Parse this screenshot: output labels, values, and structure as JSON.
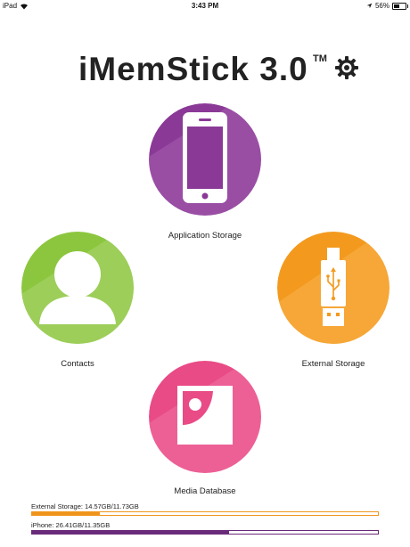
{
  "status_bar": {
    "device": "iPad",
    "time": "3:43 PM",
    "battery": "56%",
    "battery_level": 0.56
  },
  "header": {
    "title": "iMemStick 3.0",
    "trademark": "TM",
    "settings_icon": "gear-icon"
  },
  "tiles": {
    "application_storage": {
      "label": "Application Storage",
      "icon": "phone-icon",
      "color": "#8e3a98"
    },
    "contacts": {
      "label": "Contacts",
      "icon": "person-icon",
      "color": "#8cc63f"
    },
    "external_storage": {
      "label": "External Storage",
      "icon": "usb-drive-icon",
      "color": "#f39a1e"
    },
    "media_database": {
      "label": "Media Database",
      "icon": "picture-icon",
      "color": "#e94b87"
    }
  },
  "storage": {
    "external": {
      "label": "External Storage: 14.57GB/11.73GB",
      "fill_fraction": 0.195,
      "color": "#f0951c"
    },
    "iphone": {
      "label": "iPhone: 26.41GB/11.35GB",
      "fill_fraction": 0.57,
      "color": "#6a2a7a"
    }
  }
}
